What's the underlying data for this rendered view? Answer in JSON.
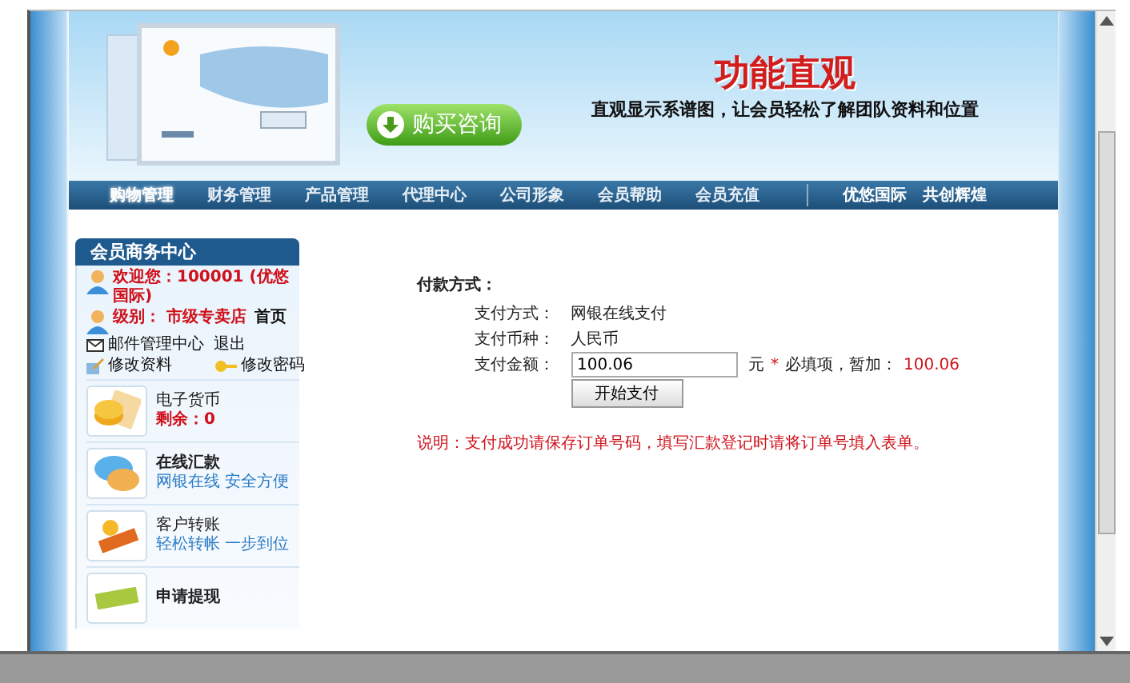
{
  "banner": {
    "button": "购买咨询",
    "title": "功能直观",
    "subtitle": "直观显示系谱图，让会员轻松了解团队资料和位置"
  },
  "nav": {
    "items": [
      {
        "label": "购物管理",
        "selected": true
      },
      {
        "label": "财务管理",
        "selected": false
      },
      {
        "label": "产品管理",
        "selected": false
      },
      {
        "label": "代理中心",
        "selected": false
      },
      {
        "label": "公司形象",
        "selected": false
      },
      {
        "label": "会员帮助",
        "selected": false
      },
      {
        "label": "会员充值",
        "selected": false
      }
    ],
    "slogan": [
      "优悠国际",
      "共创辉煌"
    ]
  },
  "sidebar": {
    "title": "会员商务中心",
    "welcome": "欢迎您：100001 (优悠国际)",
    "level": "级别： 市级专卖店",
    "home": "首页",
    "links": [
      "邮件管理中心",
      "退出",
      "修改资料",
      "修改密码"
    ],
    "services": [
      {
        "title": "电子货币",
        "subtitle": "剩余：0",
        "kind": "balance",
        "bold": false
      },
      {
        "title": "在线汇款",
        "subtitle": "网银在线 安全方便",
        "kind": "link",
        "bold": true
      },
      {
        "title": "客户转账",
        "subtitle": "轻松转帐 一步到位",
        "kind": "link",
        "bold": false
      },
      {
        "title": "申请提现",
        "bold": true
      }
    ]
  },
  "payment": {
    "heading": "付款方式：",
    "rows": [
      {
        "label": "支付方式：",
        "value": "网银在线支付"
      },
      {
        "label": "支付币种：",
        "value": "人民币"
      }
    ],
    "amount": {
      "label": "支付金额：",
      "value": "100.06",
      "unit": "元",
      "mark": "*",
      "hint": "必填项，暂加：",
      "hint_value": "100.06"
    },
    "button": "开始支付",
    "note": "说明：支付成功请保存订单号码，填写汇款登记时请将订单号填入表单。"
  }
}
